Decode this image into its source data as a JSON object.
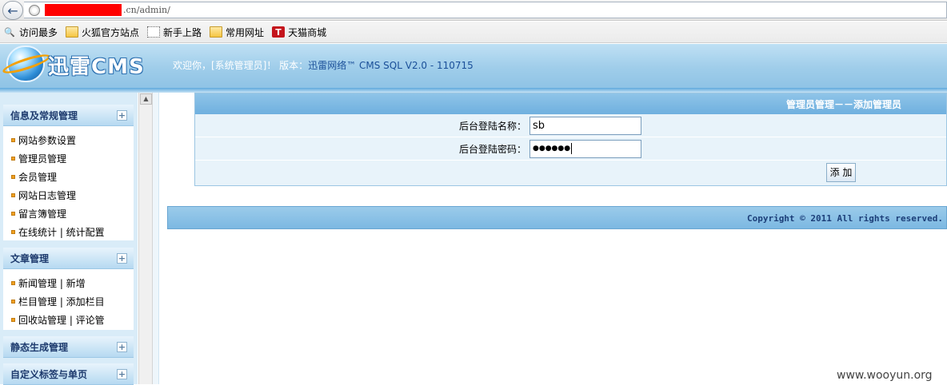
{
  "browser": {
    "url_visible": ".cn/admin/"
  },
  "bookmarks": [
    {
      "label": "访问最多",
      "icon": "most-visited-icon"
    },
    {
      "label": "火狐官方站点",
      "icon": "folder-icon"
    },
    {
      "label": "新手上路",
      "icon": "page-icon"
    },
    {
      "label": "常用网址",
      "icon": "folder-icon"
    },
    {
      "label": "天猫商城",
      "icon": "tmall-icon",
      "icon_letter": "T"
    }
  ],
  "header": {
    "logo_text": "迅雷CMS",
    "welcome": "欢迎你，[系统管理员]！ 版本：",
    "version": "迅雷网络™ CMS SQL V2.0 - 110715"
  },
  "sidebar": {
    "sections": [
      {
        "title": "信息及常规管理",
        "items": [
          "网站参数设置",
          "管理员管理",
          "会员管理",
          "网站日志管理",
          "留言簿管理",
          "在线统计 | 统计配置"
        ]
      },
      {
        "title": "文章管理",
        "items": [
          "新闻管理 | 新增",
          "栏目管理 | 添加栏目",
          "回收站管理 | 评论管"
        ]
      },
      {
        "title": "静态生成管理",
        "items": []
      },
      {
        "title": "自定义标签与单页",
        "items": []
      }
    ],
    "expand_glyph": "+"
  },
  "form": {
    "title": "管理员管理－－添加管理员",
    "username_label": "后台登陆名称：",
    "username_value": "sb",
    "password_label": "后台登陆密码：",
    "password_value": "●●●●●●",
    "submit_label": "添 加"
  },
  "footer": {
    "copyright": "Copyright © 2011 All rights reserved."
  },
  "watermark": "www.wooyun.org",
  "colors": {
    "header_blue": "#9fcdea",
    "form_title_blue": "#7fbbe4",
    "redaction": "#ff0000",
    "bullet_orange": "#f0a020"
  }
}
